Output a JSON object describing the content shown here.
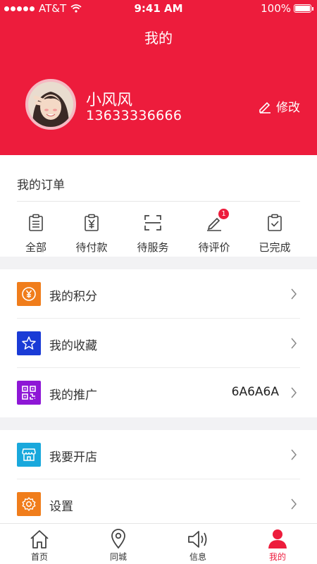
{
  "status_bar": {
    "carrier": "AT&T",
    "time": "9:41 AM",
    "battery": "100%"
  },
  "header": {
    "title": "我的"
  },
  "profile": {
    "name": "小风风",
    "phone": "13633336666",
    "edit_label": "修改"
  },
  "orders": {
    "title": "我的订单",
    "items": [
      {
        "label": "全部",
        "icon": "clipboard-icon"
      },
      {
        "label": "待付款",
        "icon": "yen-clipboard-icon"
      },
      {
        "label": "待服务",
        "icon": "scan-frame-icon"
      },
      {
        "label": "待评价",
        "icon": "pen-icon",
        "badge": "1"
      },
      {
        "label": "已完成",
        "icon": "check-clipboard-icon"
      }
    ]
  },
  "menu": [
    {
      "label": "我的积分",
      "icon": "yen-coin-icon",
      "color": "#f07d1b"
    },
    {
      "label": "我的收藏",
      "icon": "star-icon",
      "color": "#1a3bd6"
    },
    {
      "label": "我的推广",
      "icon": "qr-code-icon",
      "color": "#8e17d6",
      "value": "6A6A6A"
    },
    {
      "label": "我要开店",
      "icon": "store-icon",
      "color": "#19a8dc"
    },
    {
      "label": "设置",
      "icon": "gear-icon",
      "color": "#f07d1b"
    }
  ],
  "tabs": [
    {
      "label": "首页",
      "icon": "home-icon"
    },
    {
      "label": "同城",
      "icon": "location-pin-icon"
    },
    {
      "label": "信息",
      "icon": "speaker-icon"
    },
    {
      "label": "我的",
      "icon": "person-icon",
      "active": true
    }
  ],
  "colors": {
    "brand": "#ed1c3c"
  }
}
